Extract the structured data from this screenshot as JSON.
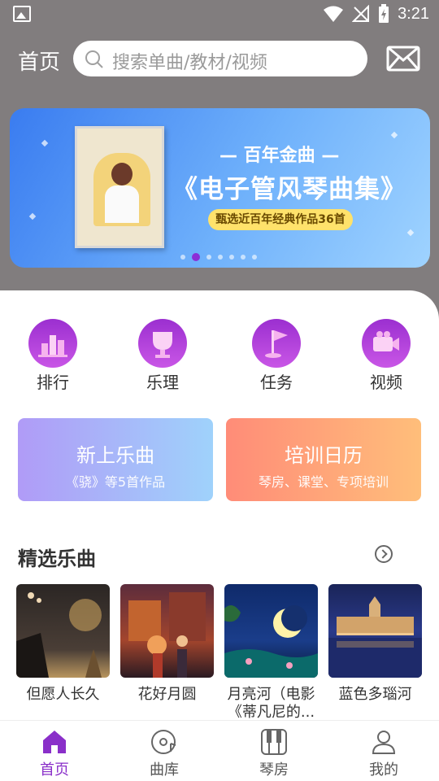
{
  "status_bar": {
    "time": "3:21"
  },
  "header": {
    "title": "首页",
    "search_placeholder": "搜索单曲/教材/视频"
  },
  "banner": {
    "subtitle": "— 百年金曲 —",
    "title": "《电子管风琴曲集》",
    "tag": "甄选近百年经典作品36首",
    "dots_count": 7,
    "active_dot": 1
  },
  "categories": [
    {
      "label": "排行",
      "icon": "ranking-icon"
    },
    {
      "label": "乐理",
      "icon": "trophy-icon"
    },
    {
      "label": "任务",
      "icon": "flag-icon"
    },
    {
      "label": "视频",
      "icon": "video-camera-icon"
    }
  ],
  "feature_cards": [
    {
      "title": "新上乐曲",
      "subtitle": "《骁》等5首作品"
    },
    {
      "title": "培训日历",
      "subtitle": "琴房、课堂、专项培训"
    }
  ],
  "section": {
    "title": "精选乐曲"
  },
  "songs": [
    {
      "name": "但愿人长久"
    },
    {
      "name": "花好月圆"
    },
    {
      "name": "月亮河（电影《蒂凡尼的..."
    },
    {
      "name": "蓝色多瑙河"
    }
  ],
  "bottom_nav": [
    {
      "label": "首页",
      "icon": "home-icon",
      "active": true
    },
    {
      "label": "曲库",
      "icon": "music-disc-icon",
      "active": false
    },
    {
      "label": "琴房",
      "icon": "piano-icon",
      "active": false
    },
    {
      "label": "我的",
      "icon": "profile-icon",
      "active": false
    }
  ],
  "colors": {
    "accent": "#8a2fc9",
    "header_bg": "#817d7e"
  }
}
